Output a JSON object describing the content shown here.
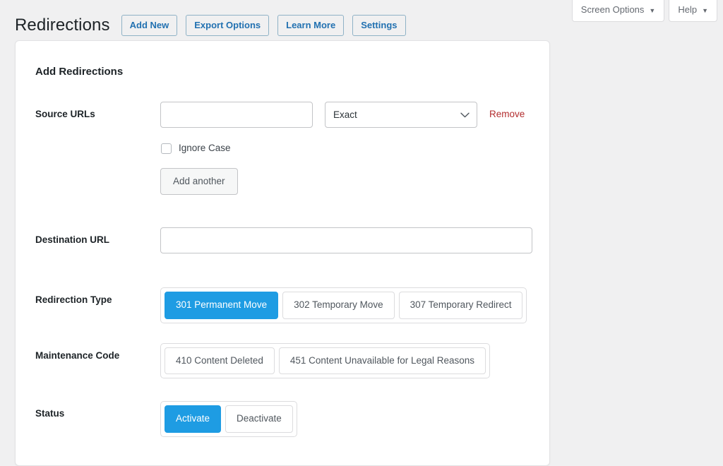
{
  "screen_meta": {
    "tabs": [
      {
        "label": "Screen Options",
        "caret": "▼",
        "icon": "chevron-down-icon"
      },
      {
        "label": "Help",
        "caret": "▼",
        "icon": "chevron-down-icon"
      }
    ]
  },
  "header": {
    "title": "Redirections",
    "actions": [
      {
        "label": "Add New"
      },
      {
        "label": "Export Options"
      },
      {
        "label": "Learn More"
      },
      {
        "label": "Settings"
      }
    ]
  },
  "card": {
    "title": "Add Redirections",
    "rows": {
      "source": {
        "label": "Source URLs",
        "input_value": "",
        "input_placeholder": "",
        "match_type": {
          "selected": "Exact",
          "options": [
            "Exact"
          ],
          "chevron_icon": "chevron-down-icon"
        },
        "remove_label": "Remove",
        "ignore_case": {
          "label": "Ignore Case",
          "checked": false
        },
        "add_another_label": "Add another"
      },
      "destination": {
        "label": "Destination URL",
        "input_value": "",
        "input_placeholder": ""
      },
      "redirection_type": {
        "label": "Redirection Type",
        "options": [
          {
            "label": "301 Permanent Move",
            "active": true
          },
          {
            "label": "302 Temporary Move",
            "active": false
          },
          {
            "label": "307 Temporary Redirect",
            "active": false
          }
        ]
      },
      "maintenance_code": {
        "label": "Maintenance Code",
        "options": [
          {
            "label": "410 Content Deleted",
            "active": false
          },
          {
            "label": "451 Content Unavailable for Legal Reasons",
            "active": false
          }
        ]
      },
      "status": {
        "label": "Status",
        "options": [
          {
            "label": "Activate",
            "active": true
          },
          {
            "label": "Deactivate",
            "active": false
          }
        ]
      }
    }
  },
  "colors": {
    "page_background": "#f0f0f1",
    "card_background": "#ffffff",
    "accent_blue": "#1e9ce3",
    "link_blue": "#2271b1",
    "danger_red": "#b32d2e",
    "text_dark": "#1d2327",
    "text_muted": "#50575e",
    "border_gray": "#c3c4c7"
  }
}
